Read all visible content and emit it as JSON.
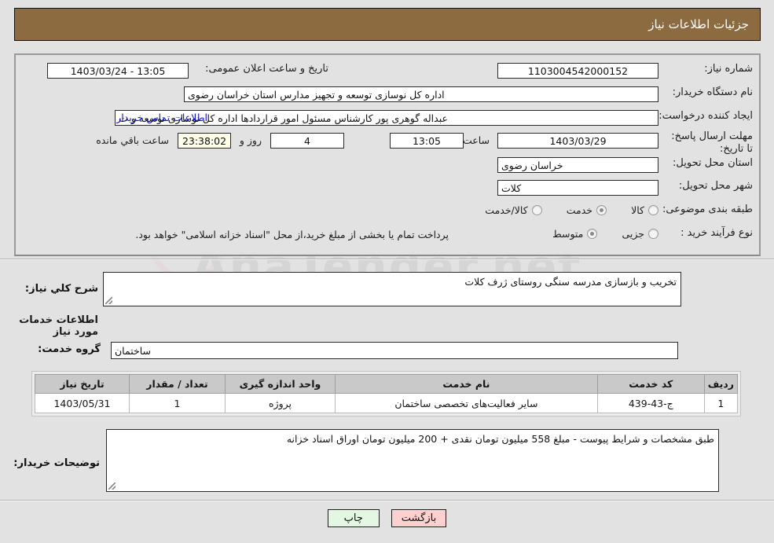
{
  "window": {
    "title": "جزئیات اطلاعات نیاز",
    "header_bg": "#8c6b41",
    "page_bg": "#e2e2e2"
  },
  "watermark": {
    "text": "AnaTender.net"
  },
  "details": {
    "need_number": {
      "label": "شماره نیاز:",
      "value": "1103004542000152"
    },
    "announce_datetime": {
      "label": "تاریخ و ساعت اعلان عمومی:",
      "value": "13:05 - 1403/03/24"
    },
    "buyer_org": {
      "label": "نام دستگاه خریدار:",
      "value": "اداره کل نوسازی  توسعه و تجهیز مدارس استان خراسان رضوی"
    },
    "requester": {
      "label": "ایجاد کننده درخواست:",
      "value": "عبداله گوهری پور کارشناس مسئول امور قراردادها  اداره کل نوسازی  توسعه و ت",
      "contact_link": "اطلاعات تماس خریدار"
    },
    "deadline": {
      "label": "مهلت ارسال پاسخ: تا تاریخ:",
      "date": "1403/03/29",
      "time_label": "ساعت",
      "time": "13:05",
      "days": "4",
      "days_label": "روز و",
      "countdown": "23:38:02",
      "remaining_label": "ساعت باقي مانده"
    },
    "delivery_province": {
      "label": "استان محل تحویل:",
      "value": "خراسان رضوی"
    },
    "delivery_city": {
      "label": "شهر محل تحویل:",
      "value": "کلات"
    },
    "category": {
      "label": "طبقه بندی موضوعی:",
      "options": [
        {
          "label": "کالا",
          "selected": false
        },
        {
          "label": "خدمت",
          "selected": true
        },
        {
          "label": "کالا/خدمت",
          "selected": false
        }
      ]
    },
    "purchase_process": {
      "label": "نوع فرآیند خرید :",
      "options": [
        {
          "label": "جزیی",
          "selected": false
        },
        {
          "label": "متوسط",
          "selected": true
        }
      ],
      "note": "پرداخت تمام یا بخشی از مبلغ خرید،از محل \"اسناد خزانه اسلامی\" خواهد بود."
    }
  },
  "body": {
    "general_desc": {
      "label": "شرح کلي نیاز:",
      "value": "تخریب و بازسازی مدرسه سنگی روستای ژرف کلات"
    },
    "services_section_title": "اطلاعات خدمات مورد نیاز",
    "service_group": {
      "label": "گروه خدمت:",
      "value": "ساختمان"
    },
    "buyer_notes": {
      "label": "توضیحات خریدار:",
      "value": "طبق مشخصات و شرایط پیوست - مبلغ 558 میلیون تومان نقدی + 200 میلیون تومان اوراق اسناد خزانه"
    }
  },
  "table": {
    "columns": [
      "ردیف",
      "کد خدمت",
      "نام خدمت",
      "واحد اندازه گیری",
      "تعداد / مقدار",
      "تاریخ نیاز"
    ],
    "rows": [
      {
        "row_no": "1",
        "service_code": "ج-43-439",
        "service_name": "سایر فعالیت‌های تخصصی ساختمان",
        "unit": "پروژه",
        "quantity": "1",
        "need_date": "1403/05/31"
      }
    ]
  },
  "footer": {
    "print_label": "چاپ",
    "back_label": "بازگشت"
  }
}
